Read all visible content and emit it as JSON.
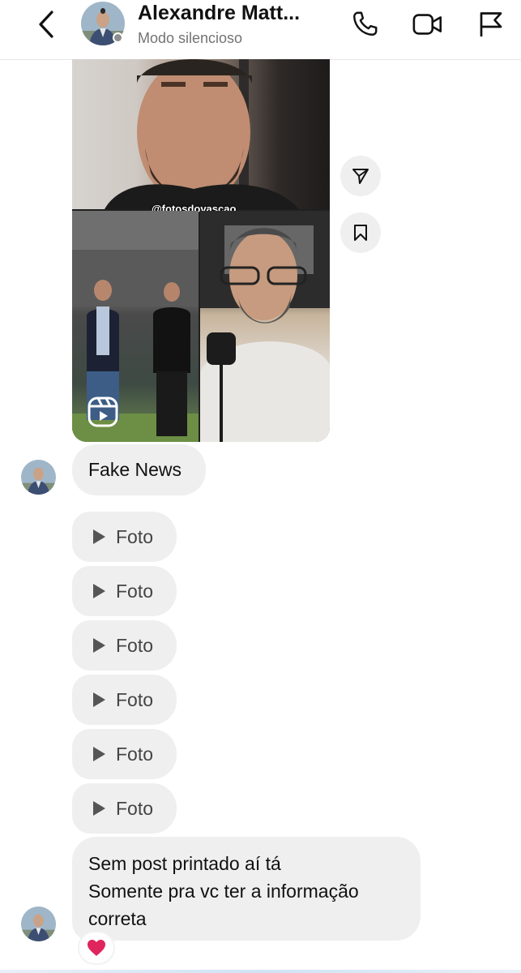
{
  "header": {
    "contact_name": "Alexandre Matt...",
    "contact_status": "Modo silencioso",
    "back_icon": "chevron-left-icon",
    "call_icon": "phone-icon",
    "video_icon": "video-camera-icon",
    "report_icon": "flag-icon"
  },
  "media": {
    "watermark": "@fotosdovascao",
    "reel_icon": "reels-icon",
    "share_icon": "send-icon",
    "save_icon": "bookmark-icon"
  },
  "messages": {
    "fake_news": "Fake News",
    "fotos": [
      "Foto",
      "Foto",
      "Foto",
      "Foto",
      "Foto",
      "Foto"
    ],
    "last_line1": "Sem post printado aí tá",
    "last_line2": "Somente pra vc ter a informação",
    "last_line3": "correta",
    "reaction": "❤️"
  },
  "colors": {
    "bubble_bg": "#efefef",
    "muted_text": "#737373",
    "heart": "#e0245e"
  }
}
